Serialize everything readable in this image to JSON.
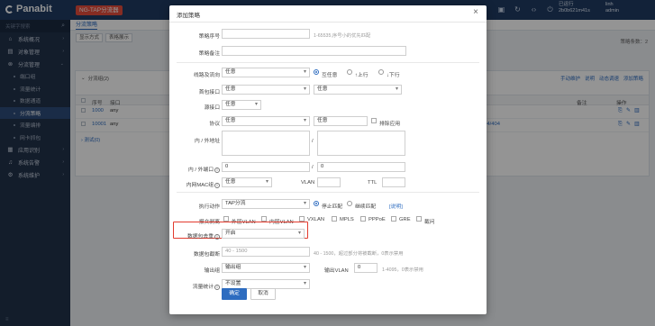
{
  "topbar": {
    "logo_text": "Panabit",
    "product_tag": "NG-TAP分流器",
    "sys_info": [
      "已运行",
      "2b0b621m41s"
    ],
    "user_info": [
      "linh",
      "admin"
    ]
  },
  "sidebar": {
    "search_placeholder": "关键字搜索",
    "items": [
      {
        "icon": "home-icon",
        "label": "系统概况"
      },
      {
        "icon": "object-icon",
        "label": "对象管理"
      },
      {
        "icon": "split-icon",
        "label": "分流管理"
      }
    ],
    "subitems": [
      {
        "label": "端口组",
        "active": false
      },
      {
        "label": "流量统计",
        "active": false
      },
      {
        "label": "数据通道",
        "active": false
      },
      {
        "label": "分流策略",
        "active": true
      },
      {
        "label": "流量编排",
        "active": false
      },
      {
        "label": "网卡抓包",
        "active": false
      }
    ],
    "items_bottom": [
      {
        "icon": "app-icon",
        "label": "应用识别"
      },
      {
        "icon": "alarm-icon",
        "label": "系统告警"
      },
      {
        "icon": "gear-icon",
        "label": "系统维护"
      }
    ]
  },
  "main": {
    "tab": "分流策略",
    "filter_label": "显示方式",
    "filter_value": "表格展示",
    "policy_count": "策略条数：2",
    "group_head": "分流组(2)",
    "tools": [
      "手动维护",
      "说明",
      "动态调速",
      "添加策略"
    ],
    "columns": [
      "序号",
      "接口",
      "备注",
      "操作"
    ],
    "rows": [
      {
        "id": "1000",
        "iface": "any",
        "right": "0"
      },
      {
        "id": "10001",
        "iface": "any",
        "right": "404/404"
      }
    ],
    "group2": "测试(0)"
  },
  "modal": {
    "title": "添加策略",
    "close": "×",
    "fields": {
      "seq_label": "策略序号",
      "seq_hint": "1-65535,序号小的优先匹配",
      "note_label": "策略备注",
      "line_label": "线路及流向",
      "line_value": "任意",
      "dir_options": [
        "互任意",
        "↑上行",
        "↓下行"
      ],
      "first_iface_label": "首包接口",
      "first_iface_value": "任意",
      "first_iface_value2": "任意",
      "src_iface_label": "源接口",
      "src_iface_value": "任意",
      "proto_label": "协议",
      "proto_value": "任意",
      "proto_value2": "任意",
      "proto_exclude": "排除应用",
      "inout_label": "内 / 外地址",
      "port_label": "内 / 外端口",
      "port_in": "0",
      "port_out": "0",
      "mac_label": "内网MAC组",
      "mac_value": "任意",
      "vlan_label": "VLAN",
      "ttl_label": "TTL",
      "action_label": "执行动作",
      "action_value": "TAP分流",
      "match_stop": "停止匹配",
      "match_continue": "继续匹配",
      "match_help": "[说明]",
      "strip_label": "报文剥离",
      "strip_options": [
        "外层VLAN",
        "内层VLAN",
        "VXLAN",
        "MPLS",
        "PPPoE",
        "GRE",
        "截问"
      ],
      "dedup_label": "数据包去重",
      "dedup_value": "开启",
      "trunc_label": "数据包截断",
      "trunc_placeholder": "40 - 1500",
      "trunc_hint": "40 - 1500，超过部分将被截断，0表示禁用",
      "out_label": "输出组",
      "out_value": "输出组",
      "out_vlan_label": "输出VLAN",
      "out_vlan_value": "0",
      "out_vlan_hint": "1-4095，0表示禁用",
      "stat_label": "流量统计",
      "stat_value": "不设置"
    },
    "confirm": "确定",
    "cancel": "取消"
  },
  "colors": {
    "topbar": "#1f3b63",
    "sidebar": "#22324a",
    "accent": "#2d6cc0",
    "highlight": "#e23b2e"
  }
}
